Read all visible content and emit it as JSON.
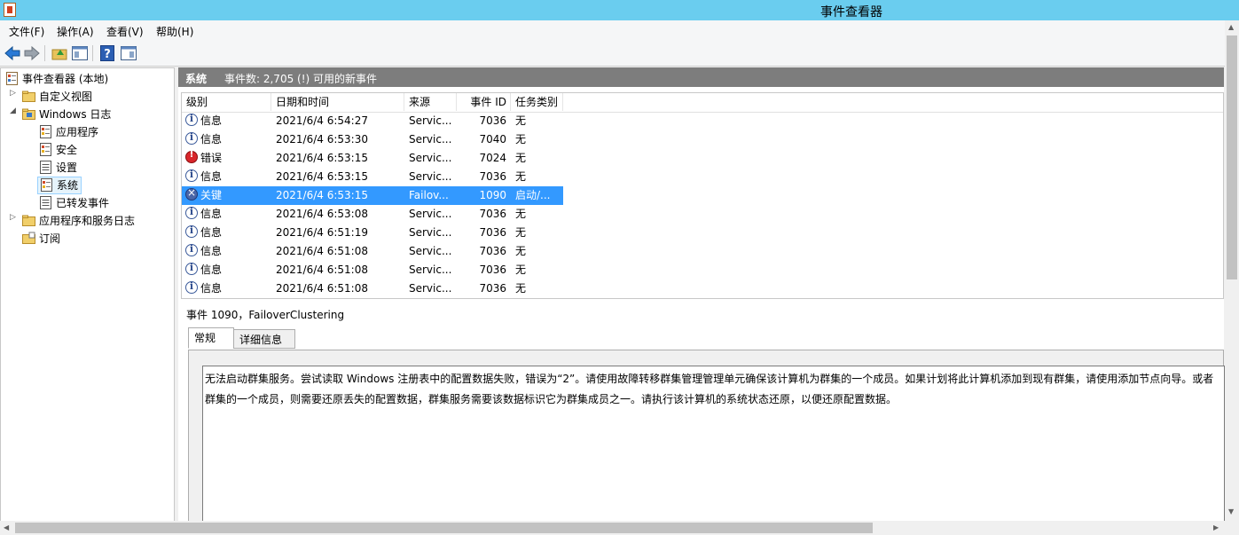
{
  "window": {
    "title": "事件查看器"
  },
  "menu": [
    "文件(F)",
    "操作(A)",
    "查看(V)",
    "帮助(H)"
  ],
  "toolbar": {
    "icons": [
      "back-arrow-icon",
      "forward-arrow-icon",
      "up-folder-icon",
      "console-tree-icon",
      "help-icon",
      "action-pane-icon"
    ]
  },
  "tree": {
    "root": "事件查看器 (本地)",
    "items": [
      {
        "label": "自定义视图"
      },
      {
        "label": "Windows 日志"
      },
      {
        "label": "应用程序"
      },
      {
        "label": "安全"
      },
      {
        "label": "设置"
      },
      {
        "label": "系统"
      },
      {
        "label": "已转发事件"
      },
      {
        "label": "应用程序和服务日志"
      },
      {
        "label": "订阅"
      }
    ]
  },
  "pane_header": {
    "log_name": "系统",
    "summary": "事件数: 2,705 (!) 可用的新事件"
  },
  "grid": {
    "columns": [
      "级别",
      "日期和时间",
      "来源",
      "事件 ID",
      "任务类别"
    ],
    "rows": [
      {
        "level": "信息",
        "level_icon": "info-icon",
        "datetime": "2021/6/4 6:54:27",
        "source": "Servic...",
        "id": "7036",
        "task": "无"
      },
      {
        "level": "信息",
        "level_icon": "info-icon",
        "datetime": "2021/6/4 6:53:30",
        "source": "Servic...",
        "id": "7040",
        "task": "无"
      },
      {
        "level": "错误",
        "level_icon": "error-icon",
        "datetime": "2021/6/4 6:53:15",
        "source": "Servic...",
        "id": "7024",
        "task": "无"
      },
      {
        "level": "信息",
        "level_icon": "info-icon",
        "datetime": "2021/6/4 6:53:15",
        "source": "Servic...",
        "id": "7036",
        "task": "无"
      },
      {
        "level": "关键",
        "level_icon": "critical-icon",
        "datetime": "2021/6/4 6:53:15",
        "source": "Failov...",
        "id": "1090",
        "task": "启动/..."
      },
      {
        "level": "信息",
        "level_icon": "info-icon",
        "datetime": "2021/6/4 6:53:08",
        "source": "Servic...",
        "id": "7036",
        "task": "无"
      },
      {
        "level": "信息",
        "level_icon": "info-icon",
        "datetime": "2021/6/4 6:51:19",
        "source": "Servic...",
        "id": "7036",
        "task": "无"
      },
      {
        "level": "信息",
        "level_icon": "info-icon",
        "datetime": "2021/6/4 6:51:08",
        "source": "Servic...",
        "id": "7036",
        "task": "无"
      },
      {
        "level": "信息",
        "level_icon": "info-icon",
        "datetime": "2021/6/4 6:51:08",
        "source": "Servic...",
        "id": "7036",
        "task": "无"
      },
      {
        "level": "信息",
        "level_icon": "info-icon",
        "datetime": "2021/6/4 6:51:08",
        "source": "Servic...",
        "id": "7036",
        "task": "无"
      }
    ]
  },
  "detail": {
    "title": "事件 1090，FailoverClustering",
    "tabs": [
      "常规",
      "详细信息"
    ],
    "description_line1": "无法启动群集服务。尝试读取 Windows 注册表中的配置数据失败，错误为“2”。请使用故障转移群集管理管理单元确保该计算机为群集的一个成员。如果计划将此计算机添加到现有群集，请使用添加节点向导。或者",
    "description_line2": "群集的一个成员，则需要还原丢失的配置数据，群集服务需要该数据标识它为群集成员之一。请执行该计算机的系统状态还原，以便还原配置数据。"
  },
  "colors": {
    "titlebar": "#6acdef",
    "selection": "#3399ff",
    "pane_header": "#7d7d7d"
  }
}
